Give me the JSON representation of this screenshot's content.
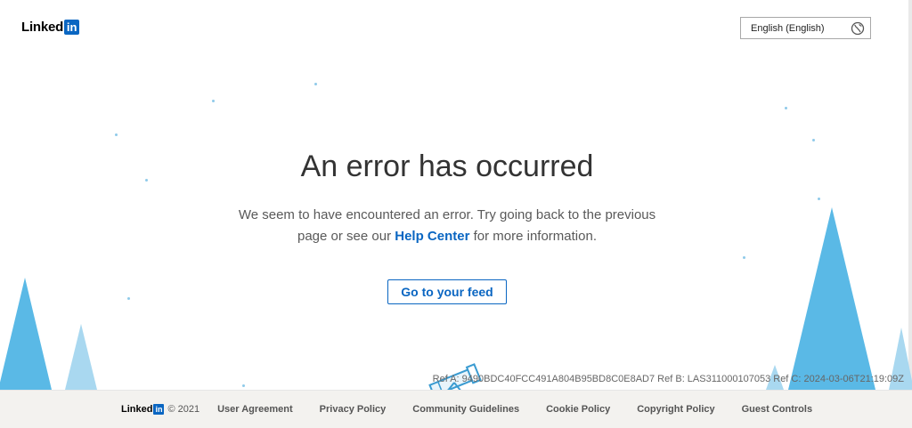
{
  "header": {
    "logo_word": "Linked",
    "logo_in": "in",
    "language_label": "English (English)"
  },
  "main": {
    "title": "An error has occurred",
    "message_before": "We seem to have encountered an error. Try going back to the previous page or see our ",
    "help_link": "Help Center",
    "message_after": " for more information.",
    "feed_button": "Go to your feed"
  },
  "ref_text": "Ref A: 9490BDC40FCC491A804B95BD8C0E8AD7 Ref B: LAS311000107053 Ref C: 2024-03-06T21:19:09Z",
  "footer": {
    "logo_word": "Linked",
    "logo_in": "in",
    "copyright": "© 2021",
    "links": [
      "User Agreement",
      "Privacy Policy",
      "Community Guidelines",
      "Cookie Policy",
      "Copyright Policy",
      "Guest Controls"
    ]
  },
  "colors": {
    "brand": "#0a66c2",
    "tree_light": "#a9d8f0",
    "tree_dark": "#5ab9e6",
    "footer_bg": "#f3f2ef"
  },
  "icons": [
    "globe-icon",
    "telescope-icon"
  ]
}
